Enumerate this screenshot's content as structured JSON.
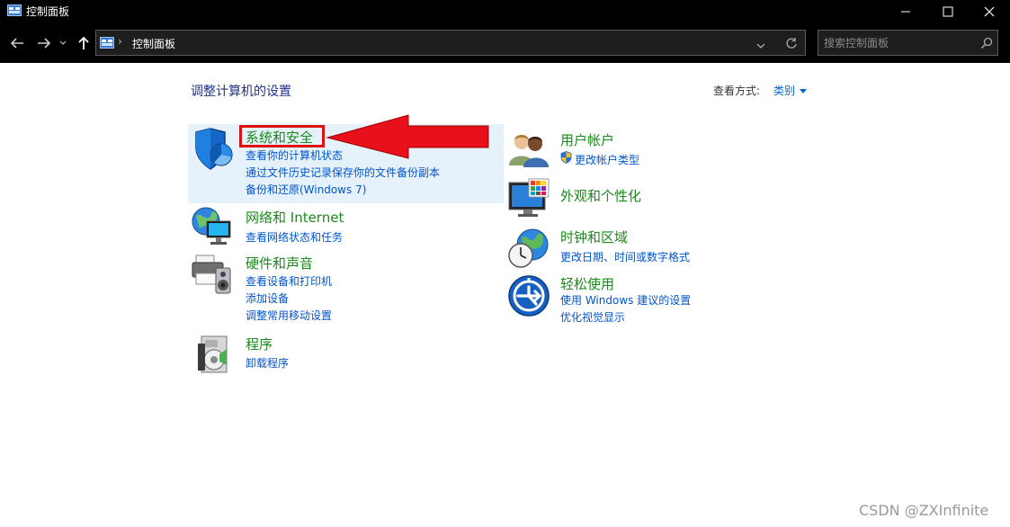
{
  "window": {
    "title": "控制面板",
    "minimize_label": "─",
    "maximize_label": "☐",
    "close_label": "✕"
  },
  "nav": {
    "back_label": "←",
    "forward_label": "→",
    "recent_label": "⌄",
    "up_label": "↑",
    "breadcrumb": "控制面板",
    "search_placeholder": "搜索控制面板"
  },
  "main": {
    "heading": "调整计算机的设置",
    "view_by_label": "查看方式:",
    "view_by_value": "类别"
  },
  "categories": [
    {
      "title": "系统和安全",
      "icon": "shield-icon",
      "links": [
        "查看你的计算机状态",
        "通过文件历史记录保存你的文件备份副本",
        "备份和还原(Windows 7)"
      ]
    },
    {
      "title": "网络和 Internet",
      "icon": "network-globe-icon",
      "links": [
        "查看网络状态和任务"
      ]
    },
    {
      "title": "硬件和声音",
      "icon": "printer-speaker-icon",
      "links": [
        "查看设备和打印机",
        "添加设备",
        "调整常用移动设置"
      ]
    },
    {
      "title": "程序",
      "icon": "programs-disc-icon",
      "links": [
        "卸载程序"
      ]
    },
    {
      "title": "用户帐户",
      "icon": "users-icon",
      "links": [
        "更改帐户类型"
      ]
    },
    {
      "title": "外观和个性化",
      "icon": "monitor-palette-icon",
      "links": []
    },
    {
      "title": "时钟和区域",
      "icon": "clock-globe-icon",
      "links": [
        "更改日期、时间或数字格式"
      ]
    },
    {
      "title": "轻松使用",
      "icon": "ease-of-access-icon",
      "links": [
        "使用 Windows 建议的设置",
        "优化视觉显示"
      ]
    }
  ],
  "watermark": "CSDN @ZXInfinite",
  "colors": {
    "category_title": "#1a8a1a",
    "link": "#0055cc",
    "highlight": "#e5f1fb",
    "annotation": "#e01010"
  }
}
